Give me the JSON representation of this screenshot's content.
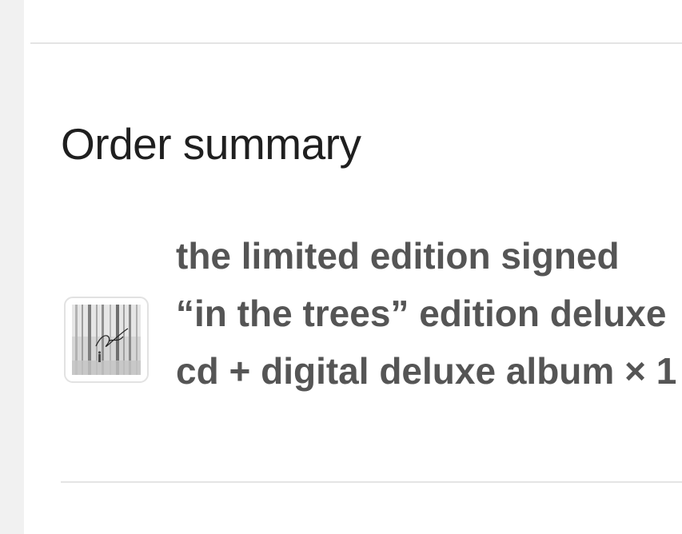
{
  "order_summary": {
    "heading": "Order summary",
    "items": [
      {
        "title": "the limited edition signed “in the trees” edition deluxe cd + digital deluxe album × 1",
        "thumbnail_icon": "album-cover-forest-image"
      }
    ]
  },
  "colors": {
    "background": "#ffffff",
    "left_strip": "#f1f1f1",
    "heading_text": "#1f1f1f",
    "item_text": "#555555",
    "divider": "#e4e4e4"
  }
}
